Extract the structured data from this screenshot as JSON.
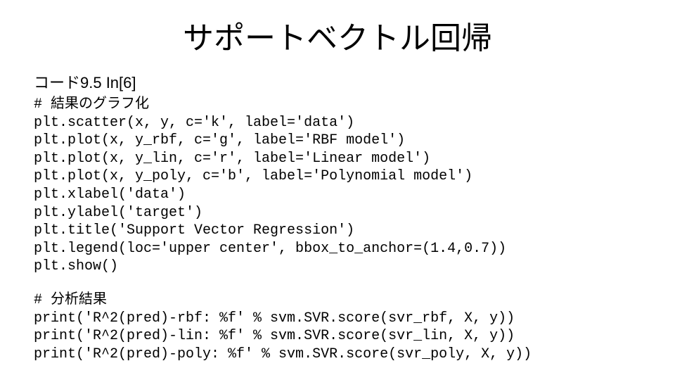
{
  "title": "サポートベクトル回帰",
  "subtitle": "コード9.5 In[6]",
  "code1": "# 結果のグラフ化\nplt.scatter(x, y, c='k', label='data')\nplt.plot(x, y_rbf, c='g', label='RBF model')\nplt.plot(x, y_lin, c='r', label='Linear model')\nplt.plot(x, y_poly, c='b', label='Polynomial model')\nplt.xlabel('data')\nplt.ylabel('target')\nplt.title('Support Vector Regression')\nplt.legend(loc='upper center', bbox_to_anchor=(1.4,0.7))\nplt.show()",
  "code2": "# 分析結果\nprint('R^2(pred)-rbf: %f' % svm.SVR.score(svr_rbf, X, y))\nprint('R^2(pred)-lin: %f' % svm.SVR.score(svr_lin, X, y))\nprint('R^2(pred)-poly: %f' % svm.SVR.score(svr_poly, X, y))"
}
